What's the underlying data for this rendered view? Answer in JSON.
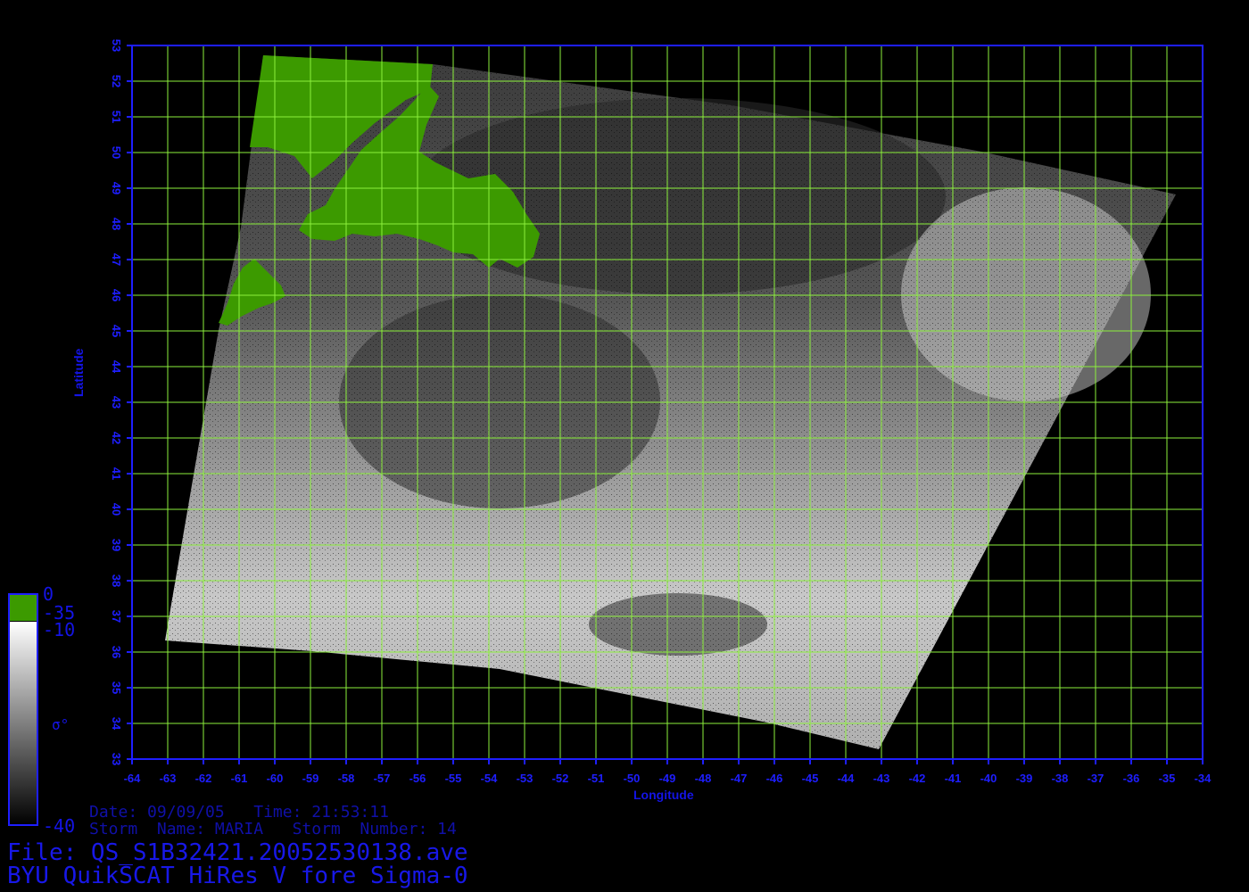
{
  "map": {
    "xlabel": "Longitude",
    "ylabel": "Latitude",
    "lon_range": [
      -64,
      -34
    ],
    "lat_range": [
      33,
      53
    ],
    "lon_ticks": [
      -64,
      -63,
      -62,
      -61,
      -60,
      -59,
      -58,
      -57,
      -56,
      -55,
      -54,
      -53,
      -52,
      -51,
      -50,
      -49,
      -48,
      -47,
      -46,
      -45,
      -44,
      -43,
      -42,
      -41,
      -40,
      -39,
      -38,
      -37,
      -36,
      -35,
      -34
    ],
    "lat_ticks": [
      33,
      34,
      35,
      36,
      37,
      38,
      39,
      40,
      41,
      42,
      43,
      44,
      45,
      46,
      47,
      48,
      49,
      50,
      51,
      52,
      53
    ],
    "grid": true,
    "colors": {
      "background": "#000000",
      "axes": "#1e1eff",
      "grid": "#8cf03c",
      "land": "#3c9a00"
    }
  },
  "colorbar": {
    "top_label": "0",
    "land_label": "-35",
    "ocean_top_label": "-10",
    "symbol_label": "σ°",
    "bottom_label": "-40"
  },
  "info": {
    "date_line": "Date: 09/09/05   Time: 21:53:11",
    "storm_line": "Storm  Name: MARIA   Storm  Number: 14",
    "file_line": "File: QS_S1B32421.20052530138.ave",
    "product_line": "BYU QuikSCAT HiRes V fore Sigma-0"
  }
}
